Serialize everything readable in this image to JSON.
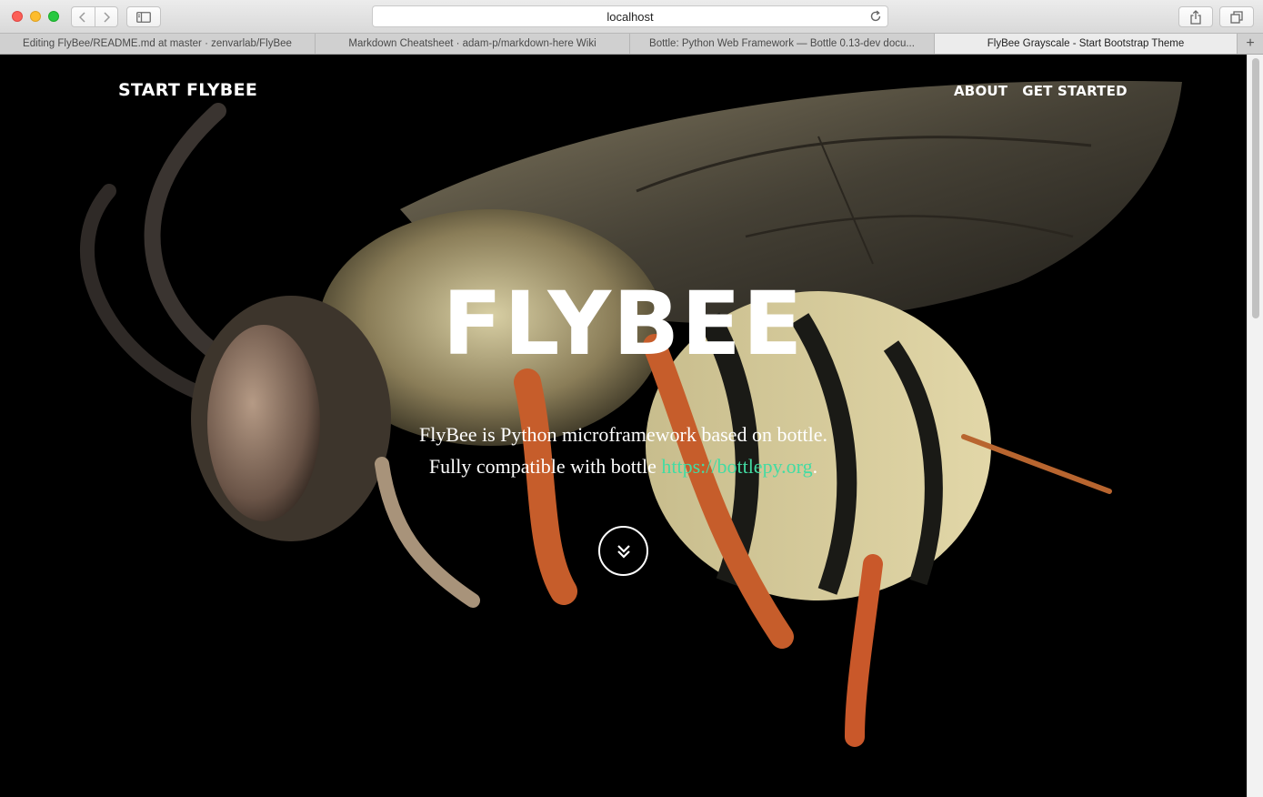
{
  "browser": {
    "address": "localhost",
    "tabs": [
      {
        "title": "Editing FlyBee/README.md at master · zenvarlab/FlyBee",
        "active": false
      },
      {
        "title": "Markdown Cheatsheet · adam-p/markdown-here Wiki",
        "active": false
      },
      {
        "title": "Bottle: Python Web Framework — Bottle 0.13-dev docu...",
        "active": false
      },
      {
        "title": "FlyBee Grayscale - Start Bootstrap Theme",
        "active": true
      }
    ],
    "new_tab_symbol": "+"
  },
  "page": {
    "brand": "START FLYBEE",
    "nav": {
      "about": "ABOUT",
      "get_started": "GET STARTED"
    },
    "hero_title": "FLYBEE",
    "intro_line1": "FlyBee is Python microframework based on bottle.",
    "intro_line2_prefix": "Fully compatible with bottle ",
    "intro_link": "https://bottlepy.org",
    "intro_line2_suffix": ".",
    "link_color": "#42dca3",
    "down_icon": "double-chevron-down-icon"
  }
}
